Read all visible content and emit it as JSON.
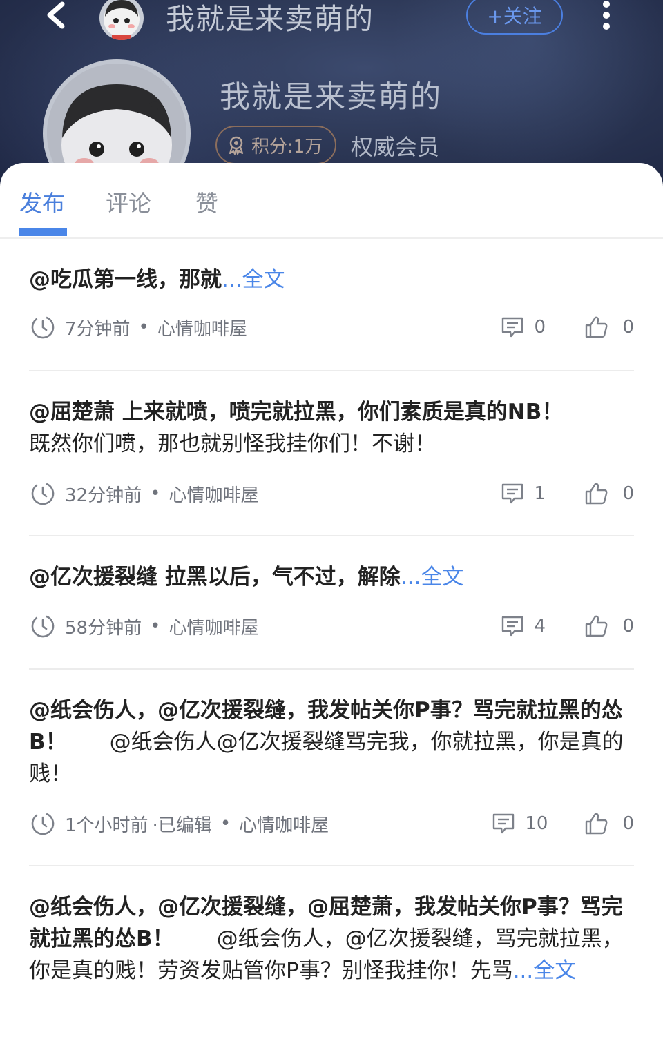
{
  "header": {
    "title": "我就是来卖萌的",
    "follow_label": "+关注",
    "profile_name": "我就是来卖萌的",
    "score_label": "积分:1万",
    "member_label": "权威会员"
  },
  "tabs": [
    {
      "label": "发布",
      "active": true
    },
    {
      "label": "评论",
      "active": false
    },
    {
      "label": "赞",
      "active": false
    }
  ],
  "posts": [
    {
      "text": "@吃瓜第一线，那就",
      "more": "...全文",
      "time": "7分钟前",
      "edited": "",
      "channel": "心情咖啡屋",
      "comments": "0",
      "likes": "0"
    },
    {
      "text": "@屈楚萧 上来就喷，喷完就拉黑，你们素质是真的NB！",
      "text2": "既然你们喷，那也就别怪我挂你们！不谢！",
      "time": "32分钟前",
      "edited": "",
      "channel": "心情咖啡屋",
      "comments": "1",
      "likes": "0"
    },
    {
      "text": "@亿次援裂缝 拉黑以后，气不过，解除",
      "more": "...全文",
      "time": "58分钟前",
      "edited": "",
      "channel": "心情咖啡屋",
      "comments": "4",
      "likes": "0"
    },
    {
      "text": "@纸会伤人，@亿次援裂缝，我发帖关你P事？骂完就拉黑的怂B！",
      "text2": "　　@纸会伤人@亿次援裂缝骂完我，你就拉黑，你是真的贱！",
      "time": "1个小时前",
      "edited": "·已编辑",
      "channel": "心情咖啡屋",
      "comments": "10",
      "likes": "0"
    },
    {
      "text": "@纸会伤人，@亿次援裂缝，@屈楚萧，我发帖关你P事？骂完就拉黑的怂B！",
      "text2": "　　@纸会伤人，@亿次援裂缝，骂完就拉黑，你是真的贱！劳资发贴管你P事？别怪我挂你！先骂",
      "more": "...全文"
    }
  ],
  "icons": {
    "back": "chevron-left-icon",
    "more": "more-vertical-icon",
    "clock": "clock-icon",
    "comment": "comment-icon",
    "like": "thumbs-up-icon",
    "score": "medal-icon"
  },
  "colors": {
    "accent": "#4a86e8",
    "header_bg": "#2c3755",
    "text": "#222222",
    "meta": "#6f737c"
  }
}
